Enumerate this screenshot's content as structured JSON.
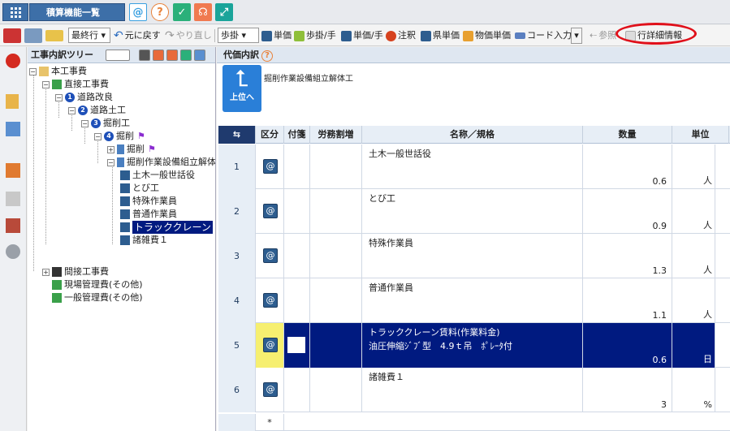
{
  "title": {
    "text": "積算機能一覧"
  },
  "title_icons": [
    {
      "name": "at-icon",
      "glyph": "@",
      "color": "#3aa0e0"
    },
    {
      "name": "help-icon",
      "glyph": "?",
      "color": "#e8823a"
    },
    {
      "name": "shield-icon",
      "glyph": "✓",
      "color": "#2bb07a"
    },
    {
      "name": "headset-icon",
      "glyph": "☊",
      "color": "#f07a50"
    },
    {
      "name": "expand-icon",
      "glyph": "⤢",
      "color": "#1aa49a"
    }
  ],
  "toolbar": {
    "level_select": "最終行",
    "undo": "元に戻す",
    "redo": "やり直し",
    "step_select": "歩掛",
    "unit_price": "単価",
    "step_hand": "歩掛/手",
    "price_hand": "単価/手",
    "note": "注釈",
    "pref_price": "県単価",
    "goods_price": "物価単価",
    "code_input": "コード入力",
    "reference": "参照",
    "row_detail": "行詳細情報"
  },
  "left_panel": {
    "title": "工事内訳ツリー"
  },
  "tree": [
    {
      "label": "本工事費"
    },
    {
      "label": "直接工事費"
    },
    {
      "label": "道路改良",
      "num": "1"
    },
    {
      "label": "道路土工",
      "num": "2"
    },
    {
      "label": "掘削工",
      "num": "3"
    },
    {
      "label": "掘削",
      "num": "4"
    },
    {
      "label": "掘削"
    },
    {
      "label": "掘削作業設備組立解体"
    },
    {
      "label": "土木一般世話役"
    },
    {
      "label": "とび工"
    },
    {
      "label": "特殊作業員"
    },
    {
      "label": "普通作業員"
    },
    {
      "label": "トラッククレーン"
    },
    {
      "label": "諸雑費１"
    },
    {
      "label": "間接工事費"
    },
    {
      "label": "現場管理費(その他)"
    },
    {
      "label": "一般管理費(その他)"
    }
  ],
  "right_panel": {
    "title": "代価内訳",
    "up_button": "上位へ",
    "breadcrumb": "掘削作業設備組立解体工"
  },
  "grid": {
    "headers": {
      "kubun": "区分",
      "fusen": "付箋",
      "roumu": "労務割増",
      "name": "名称／規格",
      "qty": "数量",
      "unit": "単位"
    },
    "rows": [
      {
        "no": "1",
        "name": "土木一般世話役",
        "spec": "",
        "qty": "0.6",
        "unit": "人"
      },
      {
        "no": "2",
        "name": "とび工",
        "spec": "",
        "qty": "0.9",
        "unit": "人"
      },
      {
        "no": "3",
        "name": "特殊作業員",
        "spec": "",
        "qty": "1.3",
        "unit": "人"
      },
      {
        "no": "4",
        "name": "普通作業員",
        "spec": "",
        "qty": "1.1",
        "unit": "人"
      },
      {
        "no": "5",
        "name": "トラッククレーン賃料(作業料金)",
        "spec": "油圧伸縮ｼﾞﾌﾞ型　4.9ｔ吊　ﾎﾟﾚｰﾀ付",
        "qty": "0.6",
        "unit": "日"
      },
      {
        "no": "6",
        "name": "諸雑費１",
        "spec": "",
        "qty": "3",
        "unit": "%"
      }
    ],
    "new_row_marker": "*"
  }
}
